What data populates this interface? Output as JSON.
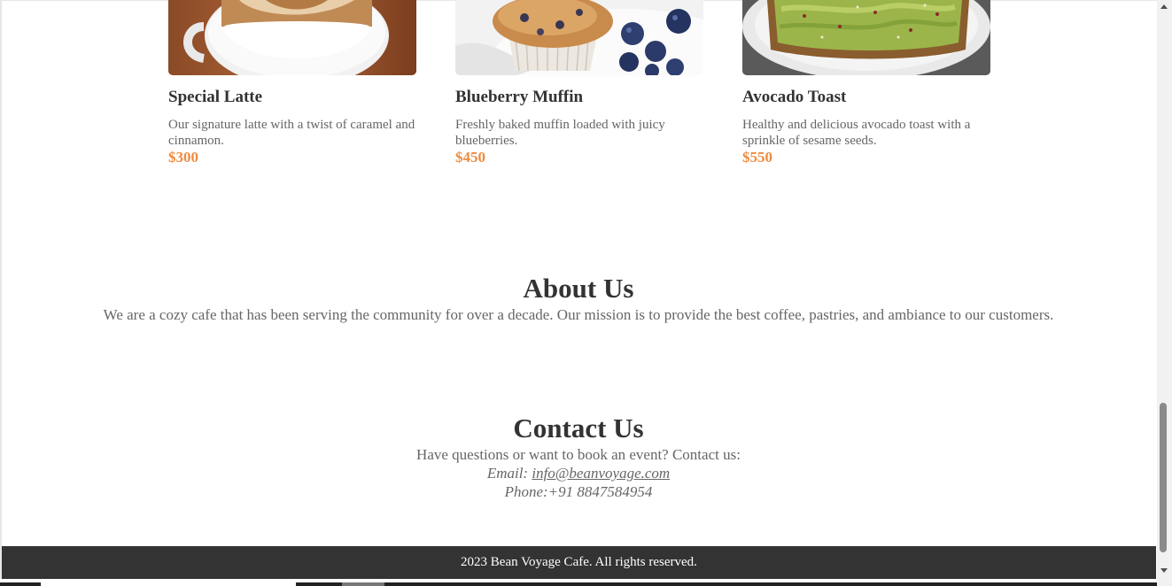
{
  "menu": {
    "items": [
      {
        "title": "Special Latte",
        "description": "Our signature latte with a twist of caramel and cinnamon.",
        "price": "$300",
        "image_icon": "latte-image"
      },
      {
        "title": "Blueberry Muffin",
        "description": "Freshly baked muffin loaded with juicy blueberries.",
        "price": "$450",
        "image_icon": "muffin-image"
      },
      {
        "title": "Avocado Toast",
        "description": "Healthy and delicious avocado toast with a sprinkle of sesame seeds.",
        "price": "$550",
        "image_icon": "avocado-toast-image"
      }
    ]
  },
  "about": {
    "title": "About Us",
    "text": "We are a cozy cafe that has been serving the community for over a decade. Our mission is to provide the best coffee, pastries, and ambiance to our customers."
  },
  "contact": {
    "title": "Contact Us",
    "text": "Have questions or want to book an event? Contact us:",
    "email_label": "Email:",
    "email": "info@beanvoyage.com",
    "phone_label": "Phone:",
    "phone": "+91 8847584954"
  },
  "footer": {
    "text": "2023 Bean Voyage Cafe. All rights reserved."
  },
  "colors": {
    "accent": "#ee8b40",
    "footer_bg": "#333333",
    "heading": "#333333",
    "body_text": "#666666"
  }
}
